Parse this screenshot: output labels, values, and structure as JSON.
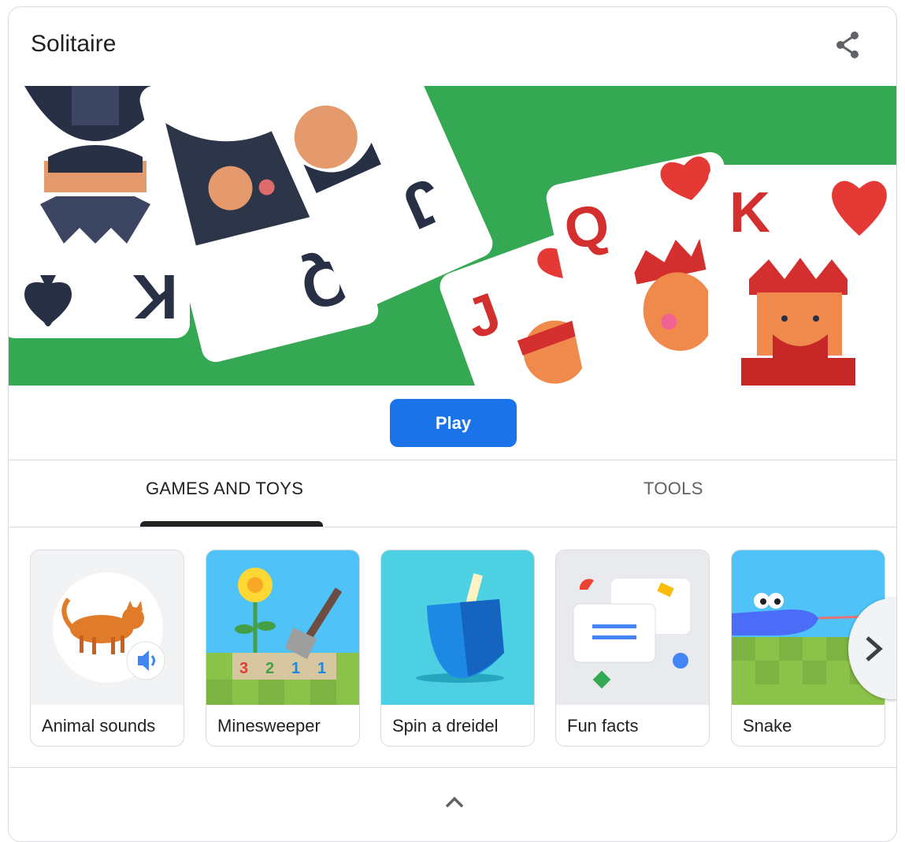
{
  "header": {
    "title": "Solitaire",
    "share_icon": "share-icon"
  },
  "hero": {
    "cards": [
      "K",
      "Q",
      "J",
      "J",
      "Q",
      "K"
    ],
    "background_color": "#34a853"
  },
  "play_button": {
    "label": "Play",
    "color": "#1a73e8"
  },
  "tabs": [
    {
      "label": "GAMES AND TOYS",
      "selected": true
    },
    {
      "label": "TOOLS",
      "selected": false
    }
  ],
  "tiles": [
    {
      "label": "Animal sounds",
      "icon": "cat-icon"
    },
    {
      "label": "Minesweeper",
      "icon": "minesweeper-icon",
      "numbers": [
        "3",
        "2",
        "1",
        "1"
      ]
    },
    {
      "label": "Spin a dreidel",
      "icon": "dreidel-icon"
    },
    {
      "label": "Fun facts",
      "icon": "fun-facts-icon"
    },
    {
      "label": "Snake",
      "icon": "snake-icon"
    }
  ],
  "carousel": {
    "next_icon": "chevron-right-icon"
  },
  "footer": {
    "collapse_icon": "chevron-up-icon"
  }
}
